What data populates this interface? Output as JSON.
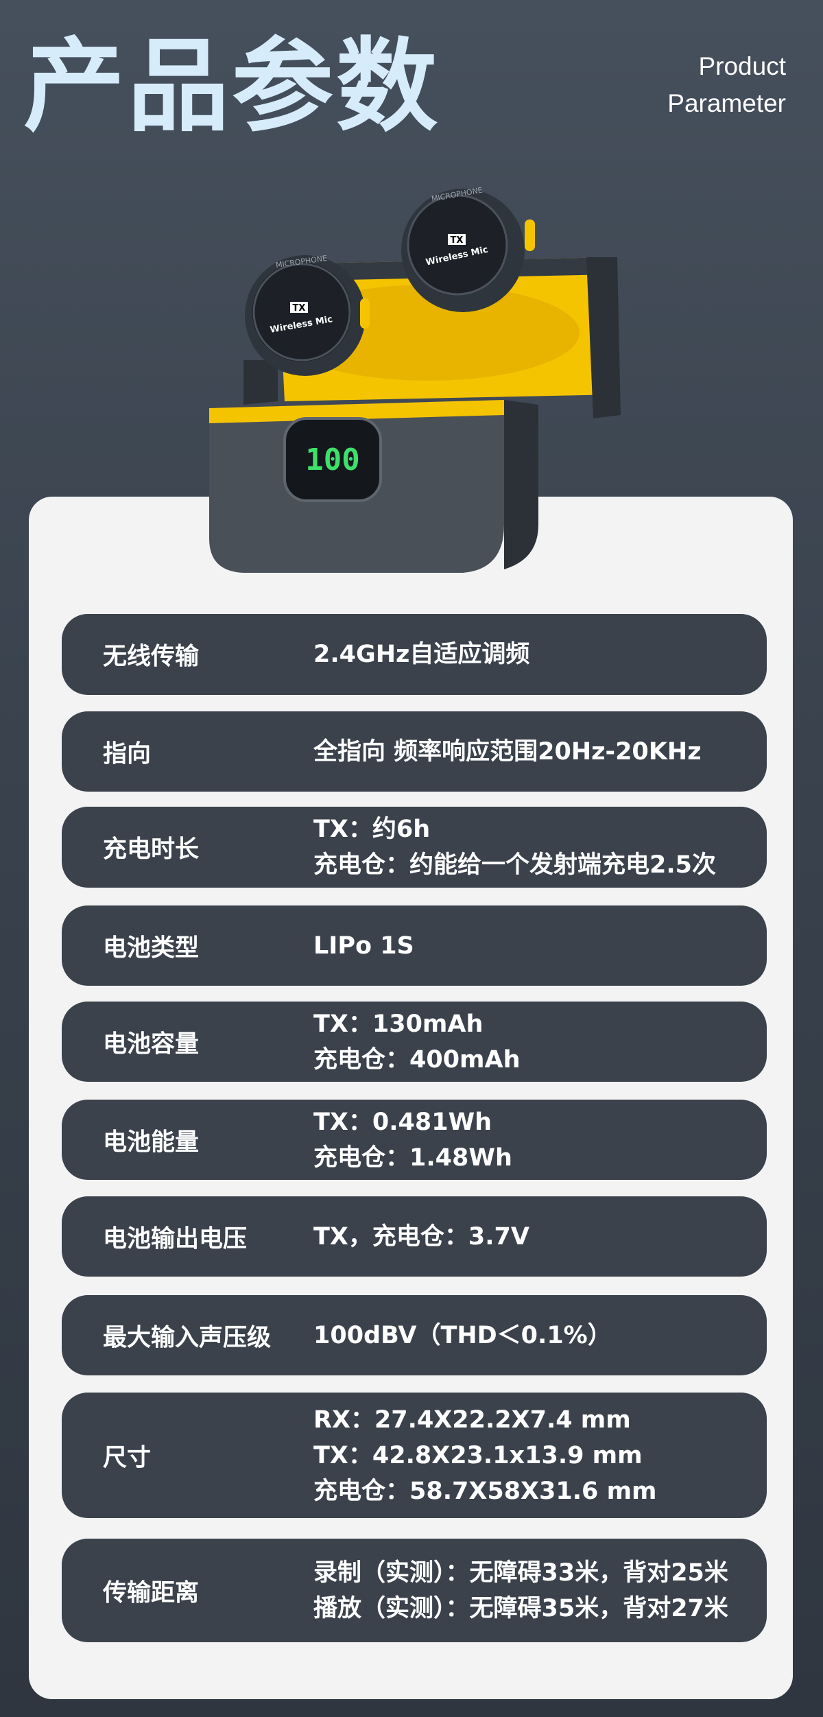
{
  "header": {
    "title": "产品参数",
    "subtitle_line1": "Product",
    "subtitle_line2": "Parameter"
  },
  "product": {
    "mic_label_top": "MICROPHONE",
    "mic_tag": "TX",
    "mic_text": "Wireless Mic",
    "case_display": "100"
  },
  "specs": [
    {
      "label": "无线传输",
      "values": [
        "2.4GHz自适应调频"
      ]
    },
    {
      "label": "指向",
      "values": [
        "全指向 频率响应范围20Hz-20KHz"
      ]
    },
    {
      "label": "充电时长",
      "values": [
        "TX：约6h",
        "充电仓：约能给一个发射端充电2.5次"
      ]
    },
    {
      "label": "电池类型",
      "values": [
        "LIPo 1S"
      ]
    },
    {
      "label": "电池容量",
      "values": [
        "TX：130mAh",
        "充电仓：400mAh"
      ]
    },
    {
      "label": "电池能量",
      "values": [
        "TX：0.481Wh",
        "充电仓：1.48Wh"
      ]
    },
    {
      "label": "电池输出电压",
      "values": [
        "TX，充电仓：3.7V"
      ]
    },
    {
      "label": "最大输入声压级",
      "values": [
        "100dBV（THD＜0.1%）"
      ]
    },
    {
      "label": "尺寸",
      "values": [
        "RX：27.4X22.2X7.4 mm",
        "TX：42.8X23.1x13.9 mm",
        "充电仓：58.7X58X31.6 mm"
      ]
    },
    {
      "label": "传输距离",
      "values": [
        "录制（实测）：无障碍33米，背对25米",
        "播放（实测）：无障碍35米，背对27米"
      ]
    }
  ],
  "colors": {
    "accent": "#f5c400",
    "row_bg": "#3b424c",
    "card_bg": "#f3f3f3",
    "title": "#d6ecfb"
  }
}
